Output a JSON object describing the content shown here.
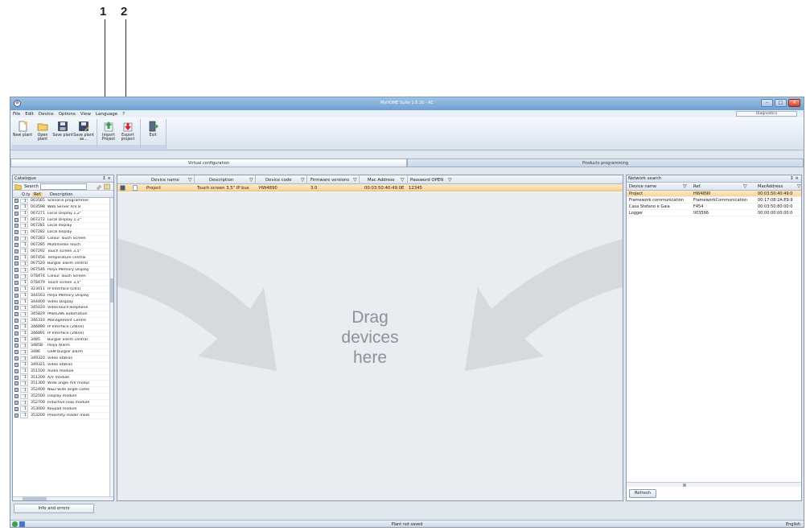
{
  "callouts": [
    "1",
    "2"
  ],
  "window": {
    "title": "MyHOME Suite 1.6.30 - RC"
  },
  "menu": [
    "File",
    "Edit",
    "Device",
    "Options",
    "View",
    "Language",
    "?"
  ],
  "diagnostics_label": "Diagnostics",
  "ribbon": {
    "buttons": [
      {
        "label": "New plant",
        "icon": "new-plant-icon"
      },
      {
        "label": "Open plant",
        "icon": "open-folder-icon"
      },
      {
        "label": "Save plant",
        "icon": "save-icon"
      },
      {
        "label": "Save plant as...",
        "icon": "save-as-icon"
      },
      {
        "label": "Import Project",
        "icon": "import-project-icon"
      },
      {
        "label": "Export project",
        "icon": "export-project-icon"
      },
      {
        "label": "Exit",
        "icon": "exit-icon"
      }
    ]
  },
  "modes": [
    "Virtual configuration",
    "Products programming"
  ],
  "catalogue": {
    "title": "Catalogue",
    "controls": "↕ ×",
    "search_label": "Search",
    "columns": [
      "Q.ty",
      "Ref.",
      "Description"
    ],
    "rows": [
      {
        "qty": "1",
        "ref": "003565",
        "desc": "Scenario programmer"
      },
      {
        "qty": "1",
        "ref": "003598",
        "desc": "Web Server A/V B"
      },
      {
        "qty": "1",
        "ref": "067271",
        "desc": "Local Display 1,2\""
      },
      {
        "qty": "1",
        "ref": "067272",
        "desc": "Local Display 1,2\""
      },
      {
        "qty": "1",
        "ref": "067281",
        "desc": "Local display"
      },
      {
        "qty": "1",
        "ref": "067282",
        "desc": "Local display"
      },
      {
        "qty": "1",
        "ref": "067283",
        "desc": "Colour Touch Screen"
      },
      {
        "qty": "1",
        "ref": "067285",
        "desc": "Multimedia Touch"
      },
      {
        "qty": "1",
        "ref": "067292",
        "desc": "Touch screen 3,5\""
      },
      {
        "qty": "1",
        "ref": "067456",
        "desc": "Temperature central"
      },
      {
        "qty": "1",
        "ref": "067520",
        "desc": "Burglar alarm central"
      },
      {
        "qty": "1",
        "ref": "067546",
        "desc": "Polyx Memory Display"
      },
      {
        "qty": "1",
        "ref": "078474",
        "desc": "Colour Touch Screen"
      },
      {
        "qty": "1",
        "ref": "078479",
        "desc": "Touch screen 3,5\""
      },
      {
        "qty": "1",
        "ref": "323011",
        "desc": "IP Interface (D45)"
      },
      {
        "qty": "1",
        "ref": "344163",
        "desc": "Polyx Memory Display"
      },
      {
        "qty": "1",
        "ref": "344400",
        "desc": "Video Display"
      },
      {
        "qty": "1",
        "ref": "345020",
        "desc": "VideoTouchTelephone"
      },
      {
        "qty": "1",
        "ref": "345829",
        "desc": "PABX286 automation"
      },
      {
        "qty": "1",
        "ref": "346310",
        "desc": "Management Centre"
      },
      {
        "qty": "1",
        "ref": "346890",
        "desc": "IP Interface (2Wire)"
      },
      {
        "qty": "1",
        "ref": "346891",
        "desc": "IP Interface (2Wire)"
      },
      {
        "qty": "1",
        "ref": "3485",
        "desc": "Burglar alarm central"
      },
      {
        "qty": "1",
        "ref": "3485B",
        "desc": "Polyx Alarm"
      },
      {
        "qty": "1",
        "ref": "3486",
        "desc": "GSM burglar alarm"
      },
      {
        "qty": "1",
        "ref": "349320",
        "desc": "Video Station"
      },
      {
        "qty": "1",
        "ref": "349321",
        "desc": "Video Station"
      },
      {
        "qty": "1",
        "ref": "351100",
        "desc": "Audio module"
      },
      {
        "qty": "1",
        "ref": "351200",
        "desc": "A/V module"
      },
      {
        "qty": "1",
        "ref": "351300",
        "desc": "Wide angle A/V module"
      },
      {
        "qty": "1",
        "ref": "352400",
        "desc": "N&D wide angle camera"
      },
      {
        "qty": "1",
        "ref": "352500",
        "desc": "Display module"
      },
      {
        "qty": "1",
        "ref": "352700",
        "desc": "Inductive loop module"
      },
      {
        "qty": "1",
        "ref": "353000",
        "desc": "Keypad module"
      },
      {
        "qty": "1",
        "ref": "353200",
        "desc": "Proximity reader module"
      }
    ]
  },
  "project_grid": {
    "columns": [
      "Device name",
      "Description",
      "Device code",
      "Firmware versions",
      "Mac Address",
      "Password OPEN"
    ],
    "row": {
      "name": "Project",
      "desc": "Touch screen 3,5\" IP bus",
      "code": "HW4890",
      "fw": "3.0",
      "mac": "00:03:50:40:49:0E",
      "pwd": "12345"
    },
    "drag_text": "Drag devices here"
  },
  "network": {
    "title": "Network search",
    "controls": "↕ ×",
    "columns": [
      "Device name",
      "Ref.",
      "MacAddress"
    ],
    "rows": [
      {
        "name": "Project",
        "ref": "HW4890",
        "mac": "00:03:50:40:49:0"
      },
      {
        "name": "Framework communication",
        "ref": "FrameworkCommunication",
        "mac": "00:17:08:2A:E9:9"
      },
      {
        "name": "Casa Stefano e Gaia",
        "ref": "F454",
        "mac": "00:03:50:80:00:0"
      },
      {
        "name": "Logger",
        "ref": "003566",
        "mac": "00:00:00:00:00:0"
      }
    ],
    "refresh_label": "Refresh"
  },
  "bottom_tab": "Info and errors",
  "status": {
    "text": "Plant not saved",
    "language": "English"
  },
  "colors": {
    "selection": "#f9d59a",
    "titlebar": "#6f9fcf",
    "accent_green": "#3aa34a",
    "accent_red": "#d8262b"
  }
}
